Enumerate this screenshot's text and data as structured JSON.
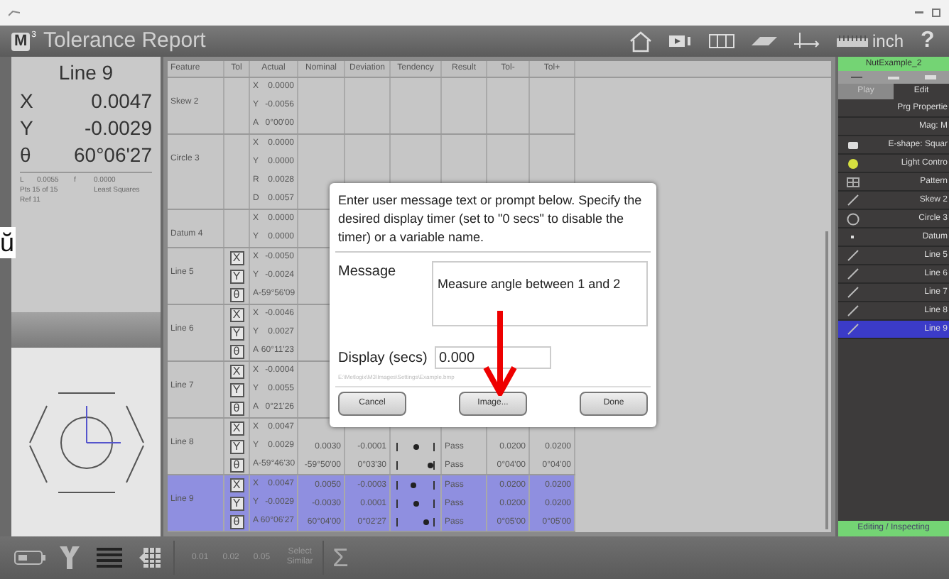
{
  "window": {
    "logo": "M",
    "logo_sup": "3",
    "title": "Tolerance Report",
    "unit": "inch",
    "help": "?"
  },
  "edge_glyph": "ŭ",
  "readout": {
    "feature": "Line 9",
    "axes": [
      {
        "label": "X",
        "value": "0.0047"
      },
      {
        "label": "Y",
        "value": "-0.0029"
      },
      {
        "label": "θ",
        "value": "60°06'27"
      }
    ],
    "details": [
      "L",
      "0.0055",
      "f",
      "0.0000",
      "Pts 15 of 15",
      "Least Squares",
      "Ref 11"
    ]
  },
  "table": {
    "columns": [
      "Feature",
      "Tol",
      "Actual",
      "Nominal",
      "Deviation",
      "Tendency",
      "Result",
      "Tol-",
      "Tol+"
    ],
    "features": [
      {
        "name": "Skew 2",
        "selected": false,
        "rows": [
          {
            "axis": "X",
            "actual": "0.0000"
          },
          {
            "axis": "Y",
            "actual": "-0.0056"
          },
          {
            "axis": "A",
            "actual": "0°00'00"
          }
        ]
      },
      {
        "name": "Circle 3",
        "selected": false,
        "rows": [
          {
            "axis": "X",
            "actual": "0.0000"
          },
          {
            "axis": "Y",
            "actual": "0.0000"
          },
          {
            "axis": "R",
            "actual": "0.0028"
          },
          {
            "axis": "D",
            "actual": "0.0057"
          }
        ]
      },
      {
        "name": "Datum 4",
        "selected": false,
        "rows": [
          {
            "axis": "X",
            "actual": "0.0000"
          },
          {
            "axis": "Y",
            "actual": "0.0000"
          }
        ]
      },
      {
        "name": "Line 5",
        "selected": false,
        "rows": [
          {
            "tol": "X",
            "axis": "X",
            "actual": "-0.0050"
          },
          {
            "tol": "Y",
            "axis": "Y",
            "actual": "-0.0024"
          },
          {
            "tol": "θ",
            "axis": "A",
            "actual": "-59°56'09"
          }
        ]
      },
      {
        "name": "Line 6",
        "selected": false,
        "rows": [
          {
            "tol": "X",
            "axis": "X",
            "actual": "-0.0046"
          },
          {
            "tol": "Y",
            "axis": "Y",
            "actual": "0.0027"
          },
          {
            "tol": "θ",
            "axis": "A",
            "actual": "60°11'23"
          }
        ]
      },
      {
        "name": "Line 7",
        "selected": false,
        "rows": [
          {
            "tol": "X",
            "axis": "X",
            "actual": "-0.0004"
          },
          {
            "tol": "Y",
            "axis": "Y",
            "actual": "0.0055"
          },
          {
            "tol": "θ",
            "axis": "A",
            "actual": "0°21'26"
          }
        ]
      },
      {
        "name": "Line 8",
        "selected": false,
        "rows": [
          {
            "tol": "X",
            "axis": "X",
            "actual": "0.0047"
          },
          {
            "tol": "Y",
            "axis": "Y",
            "actual": "0.0029",
            "nominal": "0.0030",
            "deviation": "-0.0001",
            "level": 0.5,
            "result": "Pass",
            "tol_minus": "0.0200",
            "tol_plus": "0.0200"
          },
          {
            "tol": "θ",
            "axis": "A",
            "actual": "-59°46'30",
            "nominal": "-59°50'00",
            "deviation": "0°03'30",
            "level": 0.9,
            "result": "Pass",
            "tol_minus": "0°04'00",
            "tol_plus": "0°04'00"
          }
        ]
      },
      {
        "name": "Line 9",
        "selected": true,
        "rows": [
          {
            "tol": "X",
            "axis": "X",
            "actual": "0.0047",
            "nominal": "0.0050",
            "deviation": "-0.0003",
            "level": 0.45,
            "result": "Pass",
            "tol_minus": "0.0200",
            "tol_plus": "0.0200"
          },
          {
            "tol": "Y",
            "axis": "Y",
            "actual": "-0.0029",
            "nominal": "-0.0030",
            "deviation": "0.0001",
            "level": 0.5,
            "result": "Pass",
            "tol_minus": "0.0200",
            "tol_plus": "0.0200"
          },
          {
            "tol": "θ",
            "axis": "A",
            "actual": "60°06'27",
            "nominal": "60°04'00",
            "deviation": "0°02'27",
            "level": 0.8,
            "result": "Pass",
            "tol_minus": "0°05'00",
            "tol_plus": "0°05'00"
          }
        ]
      }
    ]
  },
  "dialog": {
    "prompt": "Enter user message text or prompt below. Specify the desired display timer (set to \"0 secs\" to disable the timer) or a variable name.",
    "message_label": "Message",
    "message": "Measure angle between 1 and 2",
    "display_label": "Display (secs)",
    "display_value": "0.000",
    "image_path": "E:\\Metlogix\\M3\\Images\\Settings\\Example.bmp",
    "buttons": [
      "Cancel",
      "Image...",
      "Done"
    ]
  },
  "program": {
    "name": "NutExample_2",
    "tabs": [
      {
        "label": "Play",
        "selected": false
      },
      {
        "label": "Edit",
        "selected": true
      }
    ],
    "items": [
      {
        "label": "Prg Propertie",
        "kind": "none",
        "selected": false
      },
      {
        "label": "Mag: M",
        "kind": "none",
        "selected": false
      },
      {
        "label": "E-shape: Squar",
        "kind": "shape",
        "selected": false
      },
      {
        "label": "Light Contro",
        "kind": "bulb",
        "selected": false
      },
      {
        "label": "Pattern",
        "kind": "pattern",
        "selected": false
      },
      {
        "label": "Skew 2",
        "kind": "line",
        "selected": false
      },
      {
        "label": "Circle 3",
        "kind": "circle",
        "selected": false
      },
      {
        "label": "Datum",
        "kind": "dot",
        "selected": false
      },
      {
        "label": "Line 5",
        "kind": "line",
        "selected": false
      },
      {
        "label": "Line 6",
        "kind": "line",
        "selected": false
      },
      {
        "label": "Line 7",
        "kind": "line",
        "selected": false
      },
      {
        "label": "Line 8",
        "kind": "line",
        "selected": false
      },
      {
        "label": "Line 9",
        "kind": "line",
        "selected": true
      }
    ],
    "status": "Editing / Inspecting"
  },
  "toolbar": {
    "tolerances": [
      "0.01",
      "0.02",
      "0.05"
    ],
    "select": "Select Similar",
    "sum": "Σ"
  }
}
